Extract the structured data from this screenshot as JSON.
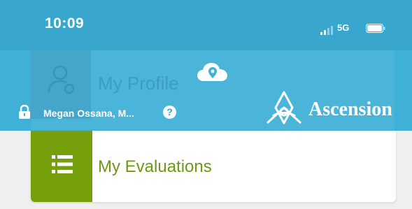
{
  "status_bar": {
    "time": "10:09",
    "network": "5G",
    "signal_icon": "signal-bars-icon",
    "battery_icon": "battery-icon"
  },
  "header": {
    "profile_label": "My Profile",
    "profile_icon": "user-settings-icon",
    "cloud_icon": "cloud-location-icon",
    "lock_icon": "lock-icon",
    "user_name": "Megan Ossana, M...",
    "help_icon": "question-icon",
    "help_glyph": "?",
    "brand": "Ascension",
    "logo_icon": "ascension-logo-icon"
  },
  "menu": {
    "evaluations_label": "My Evaluations",
    "evaluations_icon": "list-icon"
  },
  "colors": {
    "header_blue": "#3fb0d6",
    "status_blue": "#39a7cd",
    "accent_green": "#75a00b",
    "label_green": "#6f9912"
  }
}
